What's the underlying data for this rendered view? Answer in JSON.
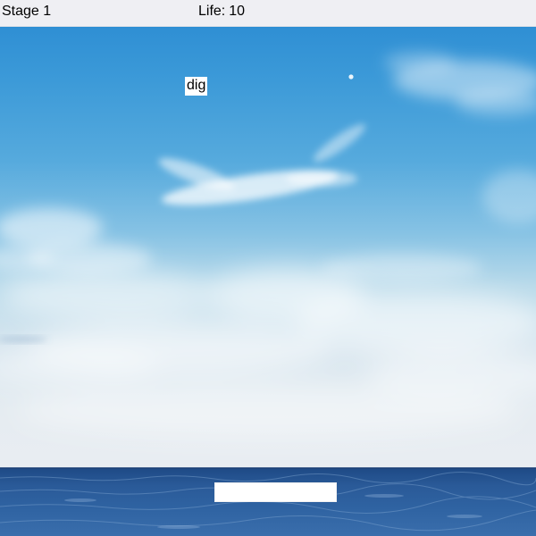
{
  "hud": {
    "stage_label": "Stage 1",
    "life_label": "Life:",
    "life_value": "10"
  },
  "falling_word": {
    "text": "dig"
  },
  "typing_input": {
    "value": ""
  },
  "colors": {
    "hud_background": "#efeff3",
    "sky_top": "#2f8fd4",
    "sky_bottom": "#e9edf2",
    "sea": "#2a5a98",
    "word_background": "#ffffff"
  }
}
